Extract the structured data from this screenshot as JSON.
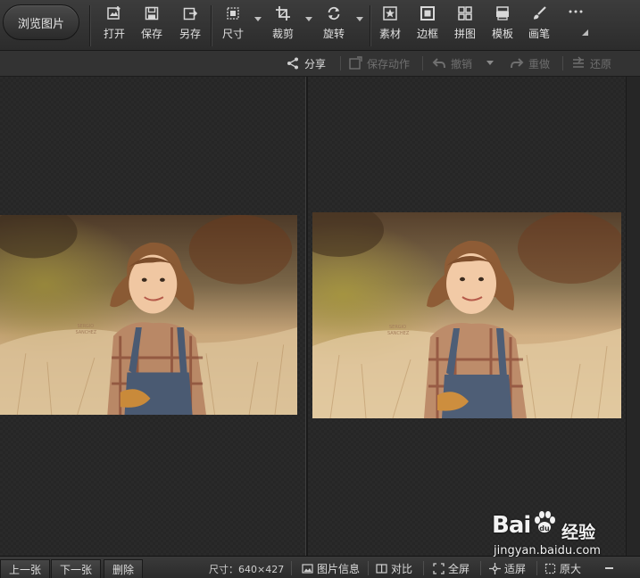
{
  "toolbar": {
    "browse_label": "浏览图片",
    "tools": [
      {
        "label": "打开",
        "icon": "open-icon"
      },
      {
        "label": "保存",
        "icon": "save-icon"
      },
      {
        "label": "另存",
        "icon": "save-as-icon"
      },
      {
        "label": "尺寸",
        "icon": "resize-icon"
      },
      {
        "label": "裁剪",
        "icon": "crop-icon"
      },
      {
        "label": "旋转",
        "icon": "rotate-icon"
      },
      {
        "label": "素材",
        "icon": "material-icon"
      },
      {
        "label": "边框",
        "icon": "border-icon"
      },
      {
        "label": "拼图",
        "icon": "collage-icon"
      },
      {
        "label": "模板",
        "icon": "template-icon"
      },
      {
        "label": "画笔",
        "icon": "brush-icon"
      }
    ],
    "more_icon": "more-icon"
  },
  "subbar": {
    "share": "分享",
    "save_action": "保存动作",
    "undo": "撤销",
    "redo": "重做",
    "restore": "还原"
  },
  "photo": {
    "watermark_line1": "SERGIO",
    "watermark_line2": "SANCHEZ"
  },
  "bottombar": {
    "prev": "上一张",
    "next": "下一张",
    "delete": "删除",
    "size": "尺寸：640×427",
    "image_info": "图片信息",
    "compare": "对比",
    "fullscreen": "全屏",
    "fit": "适屏",
    "actual": "原大"
  },
  "watermark": {
    "brand": "Bai",
    "brand_suffix": "经验",
    "url": "jingyan.baidu.com"
  },
  "colors": {
    "toolbar_bg": "#333333",
    "pane_bg": "#2a2a2a",
    "text": "#e0e0e0",
    "disabled_text": "#6f6f6f"
  }
}
